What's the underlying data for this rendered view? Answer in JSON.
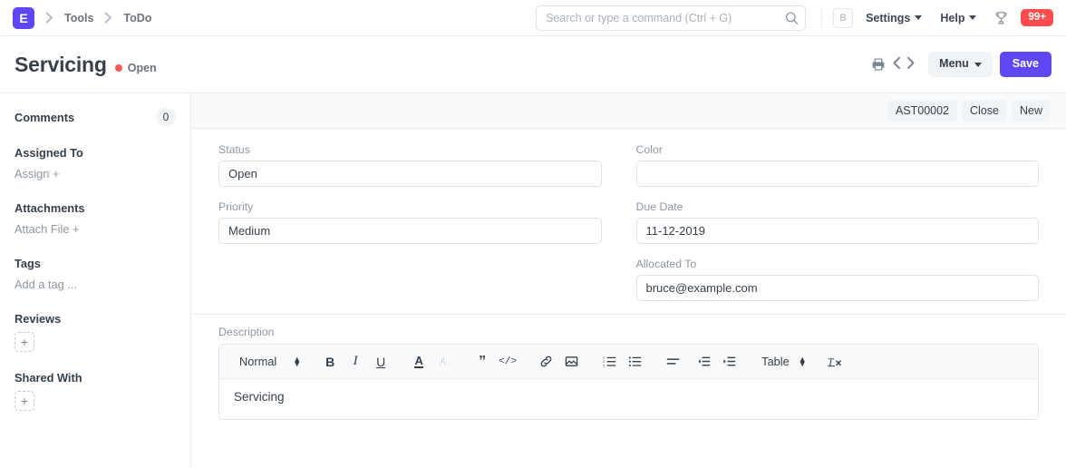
{
  "navbar": {
    "logo_text": "E",
    "breadcrumbs": [
      {
        "label": "Tools"
      },
      {
        "label": "ToDo"
      }
    ],
    "search": {
      "placeholder": "Search or type a command (Ctrl + G)",
      "value": "",
      "icon": "search-icon"
    },
    "avatar_initial": "B",
    "menus": [
      {
        "label": "Settings"
      },
      {
        "label": "Help"
      }
    ],
    "trophy_icon": "trophy-icon",
    "notification_count": "99+",
    "notification_color": "#ff4d4d"
  },
  "page_head": {
    "title": "Servicing",
    "status": "Open",
    "status_color": "#ff5858",
    "print_icon": "print-icon",
    "prev_icon": "chevron-left-icon",
    "next_icon": "chevron-right-icon",
    "menu_label": "Menu",
    "save_label": "Save",
    "save_color": "#5e48f5"
  },
  "sidebar": {
    "comments_label": "Comments",
    "comments_count": "0",
    "groups": [
      {
        "heading": "Assigned To",
        "link": "Assign +"
      },
      {
        "heading": "Attachments",
        "link": "Attach File +"
      },
      {
        "heading": "Tags",
        "link": "Add a tag ..."
      }
    ],
    "reviews_heading": "Reviews",
    "reviews_add": "+",
    "shared_heading": "Shared With",
    "shared_add": "+"
  },
  "main_toolbar": {
    "buttons": [
      {
        "label": "AST00002"
      },
      {
        "label": "Close"
      },
      {
        "label": "New"
      }
    ]
  },
  "form": {
    "left": [
      {
        "label": "Status",
        "value": "Open"
      },
      {
        "label": "Priority",
        "value": "Medium"
      }
    ],
    "right": [
      {
        "label": "Color",
        "value": ""
      },
      {
        "label": "Due Date",
        "value": "11-12-2019"
      },
      {
        "label": "Allocated To",
        "value": "bruce@example.com"
      }
    ]
  },
  "description": {
    "label": "Description",
    "toolbar": {
      "style_label": "Normal",
      "table_label": "Table",
      "tools": [
        "bold-icon",
        "italic-icon",
        "underline-icon",
        "text-color-icon",
        "highlight-icon",
        "blockquote-icon",
        "code-icon",
        "link-icon",
        "image-icon",
        "ordered-list-icon",
        "bullet-list-icon",
        "align-icon",
        "outdent-icon",
        "indent-icon",
        "clear-format-icon"
      ]
    },
    "content": "Servicing"
  }
}
